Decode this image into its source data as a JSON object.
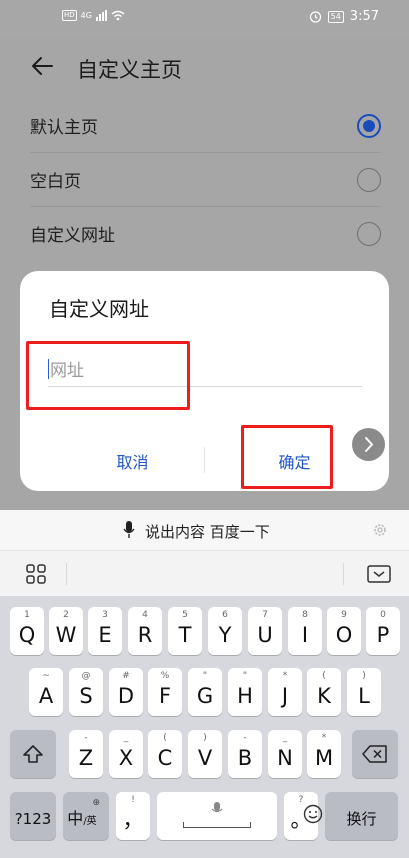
{
  "status_bar": {
    "hd": "HD",
    "network": "4G",
    "battery": "54",
    "time": "3:57"
  },
  "header": {
    "title": "自定义主页"
  },
  "options": [
    {
      "label": "默认主页",
      "checked": true
    },
    {
      "label": "空白页",
      "checked": false
    },
    {
      "label": "自定义网址",
      "checked": false
    }
  ],
  "dialog": {
    "title": "自定义网址",
    "input_placeholder": "网址",
    "input_value": "",
    "cancel_label": "取消",
    "ok_label": "确定"
  },
  "keyboard": {
    "voice_label": "说出内容 百度一下",
    "row1": [
      {
        "main": "Q",
        "hint": "1"
      },
      {
        "main": "W",
        "hint": "2"
      },
      {
        "main": "E",
        "hint": "3"
      },
      {
        "main": "R",
        "hint": "4"
      },
      {
        "main": "T",
        "hint": "5"
      },
      {
        "main": "Y",
        "hint": "6"
      },
      {
        "main": "U",
        "hint": "7"
      },
      {
        "main": "I",
        "hint": "8"
      },
      {
        "main": "O",
        "hint": "9"
      },
      {
        "main": "P",
        "hint": "0"
      }
    ],
    "row2": [
      {
        "main": "A",
        "hint": "~"
      },
      {
        "main": "S",
        "hint": "@"
      },
      {
        "main": "D",
        "hint": "#"
      },
      {
        "main": "F",
        "hint": "%"
      },
      {
        "main": "G",
        "hint": "\""
      },
      {
        "main": "H",
        "hint": "\""
      },
      {
        "main": "J",
        "hint": "*"
      },
      {
        "main": "K",
        "hint": "("
      },
      {
        "main": "L",
        "hint": ")"
      }
    ],
    "row3": [
      {
        "main": "Z",
        "hint": "-"
      },
      {
        "main": "X",
        "hint": "_"
      },
      {
        "main": "C",
        "hint": "("
      },
      {
        "main": "V",
        "hint": ")"
      },
      {
        "main": "B",
        "hint": "-"
      },
      {
        "main": "N",
        "hint": "_"
      },
      {
        "main": "M",
        "hint": "*"
      }
    ],
    "row4": {
      "symbols": "?123",
      "lang_main": "中",
      "lang_sub": "/英",
      "comma": "，",
      "period": "。",
      "period_hint": "?",
      "comma_hint": "!",
      "enter": "换行"
    }
  },
  "colors": {
    "accent": "#1a4bbd",
    "highlight": "#ee1c1c"
  }
}
